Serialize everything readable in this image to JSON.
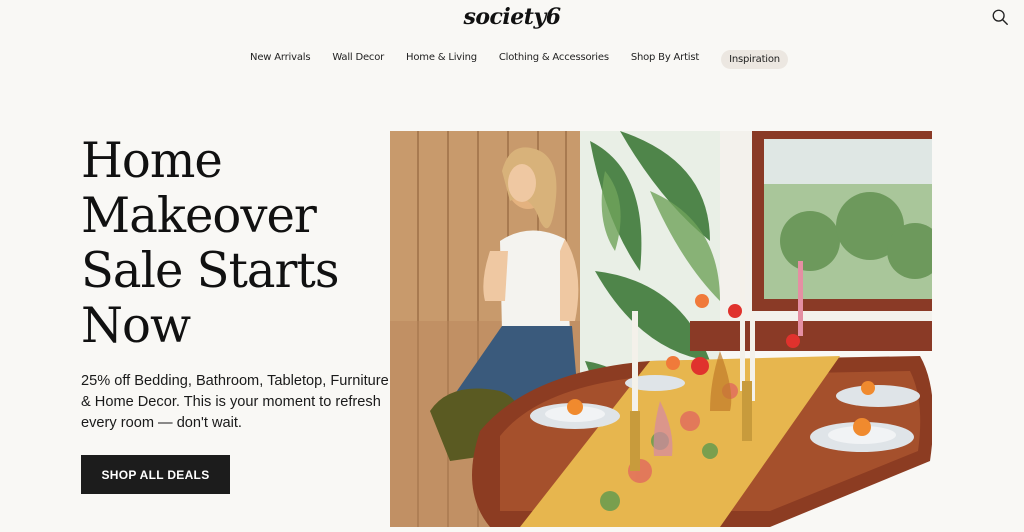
{
  "brand": {
    "logo_text": "society6"
  },
  "header": {
    "search_icon": "search-icon",
    "nav": [
      {
        "label": "New Arrivals"
      },
      {
        "label": "Wall Decor"
      },
      {
        "label": "Home & Living"
      },
      {
        "label": "Clothing & Accessories"
      },
      {
        "label": "Shop By Artist"
      },
      {
        "label": "Inspiration"
      }
    ]
  },
  "hero": {
    "headline_lines": [
      "Home",
      "Makeover",
      "Sale Starts",
      "Now"
    ],
    "subtext": "25% off Bedding, Bathroom, Tabletop, Furniture & Home Decor. This is your moment to refresh every room — don't wait.",
    "cta_label": "SHOP ALL DEALS",
    "image_alt": "Woman at a dining table set with floral runner, candles and flowers"
  },
  "colors": {
    "background": "#f9f8f5",
    "cta_bg": "#1c1c1c",
    "pill_bg": "#ece7e1"
  }
}
